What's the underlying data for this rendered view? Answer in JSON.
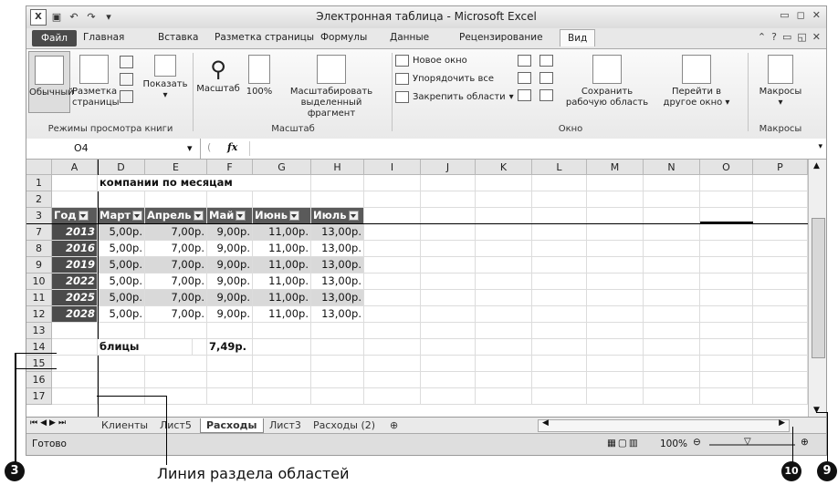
{
  "window": {
    "title": "Электронная таблица - Microsoft Excel"
  },
  "ribbon_tabs": [
    "Файл",
    "Главная",
    "Вставка",
    "Разметка страницы",
    "Формулы",
    "Данные",
    "Рецензирование",
    "Вид"
  ],
  "ribbon": {
    "normal": "Обычный",
    "page_layout_1": "Разметка",
    "page_layout_2": "страницы",
    "show": "Показать",
    "zoom": "Масштаб",
    "zoom100": "100%",
    "zoom_sel_1": "Масштабировать",
    "zoom_sel_2": "выделенный фрагмент",
    "new_window": "Новое окно",
    "arrange_all": "Упорядочить все",
    "freeze": "Закрепить области",
    "save_ws_1": "Сохранить",
    "save_ws_2": "рабочую область",
    "switch_1": "Перейти в",
    "switch_2": "другое окно",
    "macros": "Макросы",
    "grp_views": "Режимы просмотра книги",
    "grp_zoom": "Масштаб",
    "grp_window": "Окно",
    "grp_macros": "Макросы"
  },
  "formula_bar": {
    "name_box": "O4",
    "fx": "fx",
    "formula": ""
  },
  "columns": [
    "A",
    "D",
    "E",
    "F",
    "G",
    "H",
    "I",
    "J",
    "K",
    "L",
    "M",
    "N",
    "O",
    "P"
  ],
  "row_numbers": [
    "1",
    "2",
    "3",
    "7",
    "8",
    "9",
    "10",
    "11",
    "12",
    "13",
    "14",
    "15",
    "16",
    "17"
  ],
  "sheet": {
    "title_text": "компании по месяцам",
    "headers": [
      "Год",
      "Март",
      "Апрель",
      "Май",
      "Июнь",
      "Июль"
    ],
    "rows": [
      [
        "2013",
        "5,00р.",
        "7,00р.",
        "9,00р.",
        "11,00р.",
        "13,00р."
      ],
      [
        "2016",
        "5,00р.",
        "7,00р.",
        "9,00р.",
        "11,00р.",
        "13,00р."
      ],
      [
        "2019",
        "5,00р.",
        "7,00р.",
        "9,00р.",
        "11,00р.",
        "13,00р."
      ],
      [
        "2022",
        "5,00р.",
        "7,00р.",
        "9,00р.",
        "11,00р.",
        "13,00р."
      ],
      [
        "2025",
        "5,00р.",
        "7,00р.",
        "9,00р.",
        "11,00р.",
        "13,00р."
      ],
      [
        "2028",
        "5,00р.",
        "7,00р.",
        "9,00р.",
        "11,00р.",
        "13,00р."
      ]
    ],
    "row14_label": "блицы",
    "row14_value": "7,49р."
  },
  "sheet_tabs": [
    "Клиенты",
    "Лист5",
    "Расходы",
    "Лист3",
    "Расходы (2)"
  ],
  "status": {
    "ready": "Готово",
    "zoom": "100%"
  },
  "callouts": {
    "c3": "3",
    "c10": "10",
    "c9": "9",
    "caption": "Линия раздела областей"
  }
}
